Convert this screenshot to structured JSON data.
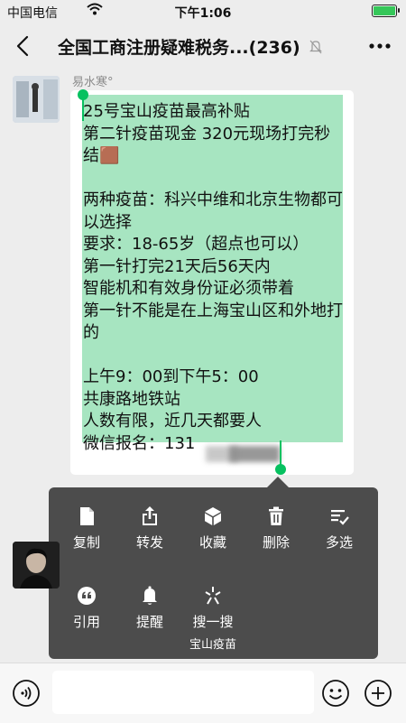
{
  "status_bar": {
    "carrier": "中国电信",
    "time": "下午1:06"
  },
  "header": {
    "title": "全国工商注册疑难税务...",
    "member_count": "(236)"
  },
  "message": {
    "sender": "易水寒°",
    "text_lines": [
      "25号宝山疫苗最高补贴",
      "第二针疫苗现金 320元现场打完秒结🟫",
      "",
      "两种疫苗：科兴中维和北京生物都可以选择",
      "要求：18-65岁（超点也可以）",
      "第一针打完21天后56天内",
      "智能机和有效身份证必须带着",
      "第一针不能是在上海宝山区和外地打的",
      "",
      "上午9：00到下午5：00",
      "共康路地铁站",
      "人数有限，近几天都要人",
      "微信报名：131"
    ]
  },
  "context_menu": {
    "row1": [
      {
        "icon": "copy-icon",
        "label": "复制"
      },
      {
        "icon": "forward-icon",
        "label": "转发"
      },
      {
        "icon": "favorite-icon",
        "label": "收藏"
      },
      {
        "icon": "delete-icon",
        "label": "删除"
      },
      {
        "icon": "multi-select-icon",
        "label": "多选"
      }
    ],
    "row2": [
      {
        "icon": "quote-icon",
        "label": "引用"
      },
      {
        "icon": "remind-icon",
        "label": "提醒"
      },
      {
        "icon": "search-icon",
        "label": "搜一搜",
        "sub": "宝山疫苗"
      }
    ]
  },
  "colors": {
    "selection": "#a7e5c1",
    "handle": "#07c160",
    "menu_bg": "#4c4c4c",
    "chat_bg": "#ededed"
  }
}
